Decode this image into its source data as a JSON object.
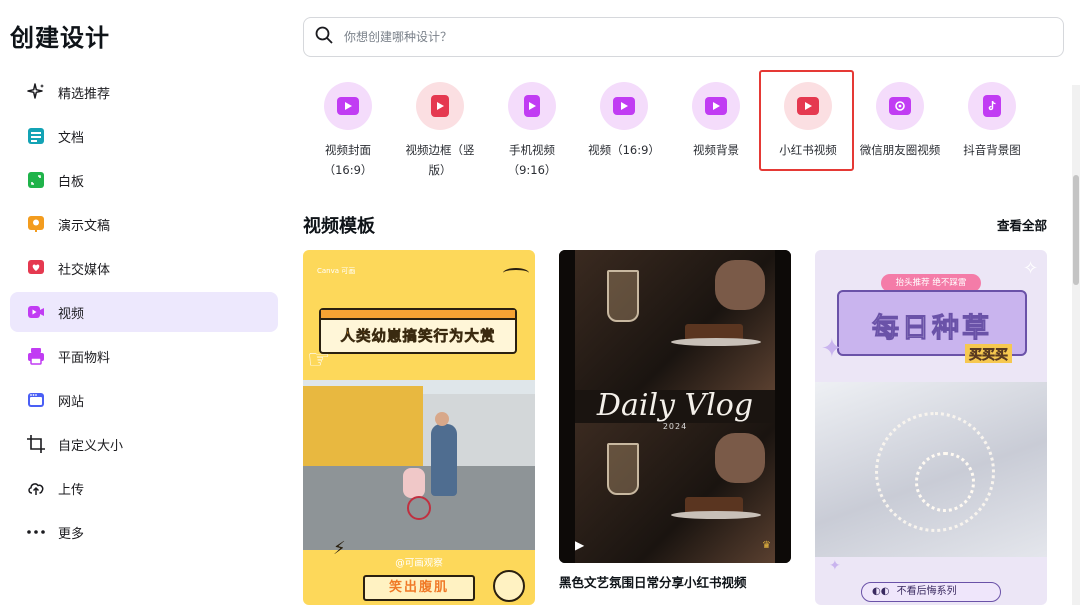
{
  "app": {
    "title": "创建设计"
  },
  "search": {
    "placeholder": "你想创建哪种设计？"
  },
  "sidebar": {
    "items": [
      {
        "label": "精选推荐",
        "icon": "sparkle-icon"
      },
      {
        "label": "文档",
        "icon": "doc-icon"
      },
      {
        "label": "白板",
        "icon": "whiteboard-icon"
      },
      {
        "label": "演示文稿",
        "icon": "presentation-icon"
      },
      {
        "label": "社交媒体",
        "icon": "heart-icon"
      },
      {
        "label": "视频",
        "icon": "video-icon"
      },
      {
        "label": "平面物料",
        "icon": "print-icon"
      },
      {
        "label": "网站",
        "icon": "website-icon"
      },
      {
        "label": "自定义大小",
        "icon": "crop-icon"
      },
      {
        "label": "上传",
        "icon": "cloud-upload-icon"
      },
      {
        "label": "更多",
        "icon": "more-icon"
      }
    ],
    "active_index": 5
  },
  "categories": [
    {
      "label": "视频封面（16:9）",
      "icon": "video-cover-icon",
      "color": "#c13cf3"
    },
    {
      "label": "视频边框（竖版）",
      "icon": "video-frame-icon",
      "color": "#e53950"
    },
    {
      "label": "手机视频（9:16）",
      "icon": "phone-video-icon",
      "color": "#c13cf3"
    },
    {
      "label": "视频（16:9）",
      "icon": "video-icon",
      "color": "#c13cf3"
    },
    {
      "label": "视频背景",
      "icon": "video-bg-icon",
      "color": "#c13cf3"
    },
    {
      "label": "小红书视频",
      "icon": "xiaohongshu-video-icon",
      "color": "#e53950"
    },
    {
      "label": "微信朋友圈视频",
      "icon": "wechat-moments-icon",
      "color": "#c13cf3"
    },
    {
      "label": "抖音背景图",
      "icon": "douyin-icon",
      "color": "#c13cf3"
    }
  ],
  "section": {
    "title": "视频模板",
    "see_all": "查看全部"
  },
  "templates": [
    {
      "headline": "人类幼崽搞笑行为大赏",
      "brand": "Canva 可画",
      "handle": "@可画观察",
      "cta": "笑出腹肌"
    },
    {
      "script": "Daily Vlog",
      "year": "2024",
      "caption": "黑色文艺氛围日常分享小红书视频"
    },
    {
      "tag": "抬头推荐 绝不踩雷",
      "headline": "每日种草",
      "sub": "买买买",
      "footer": "不看后悔系列"
    }
  ]
}
